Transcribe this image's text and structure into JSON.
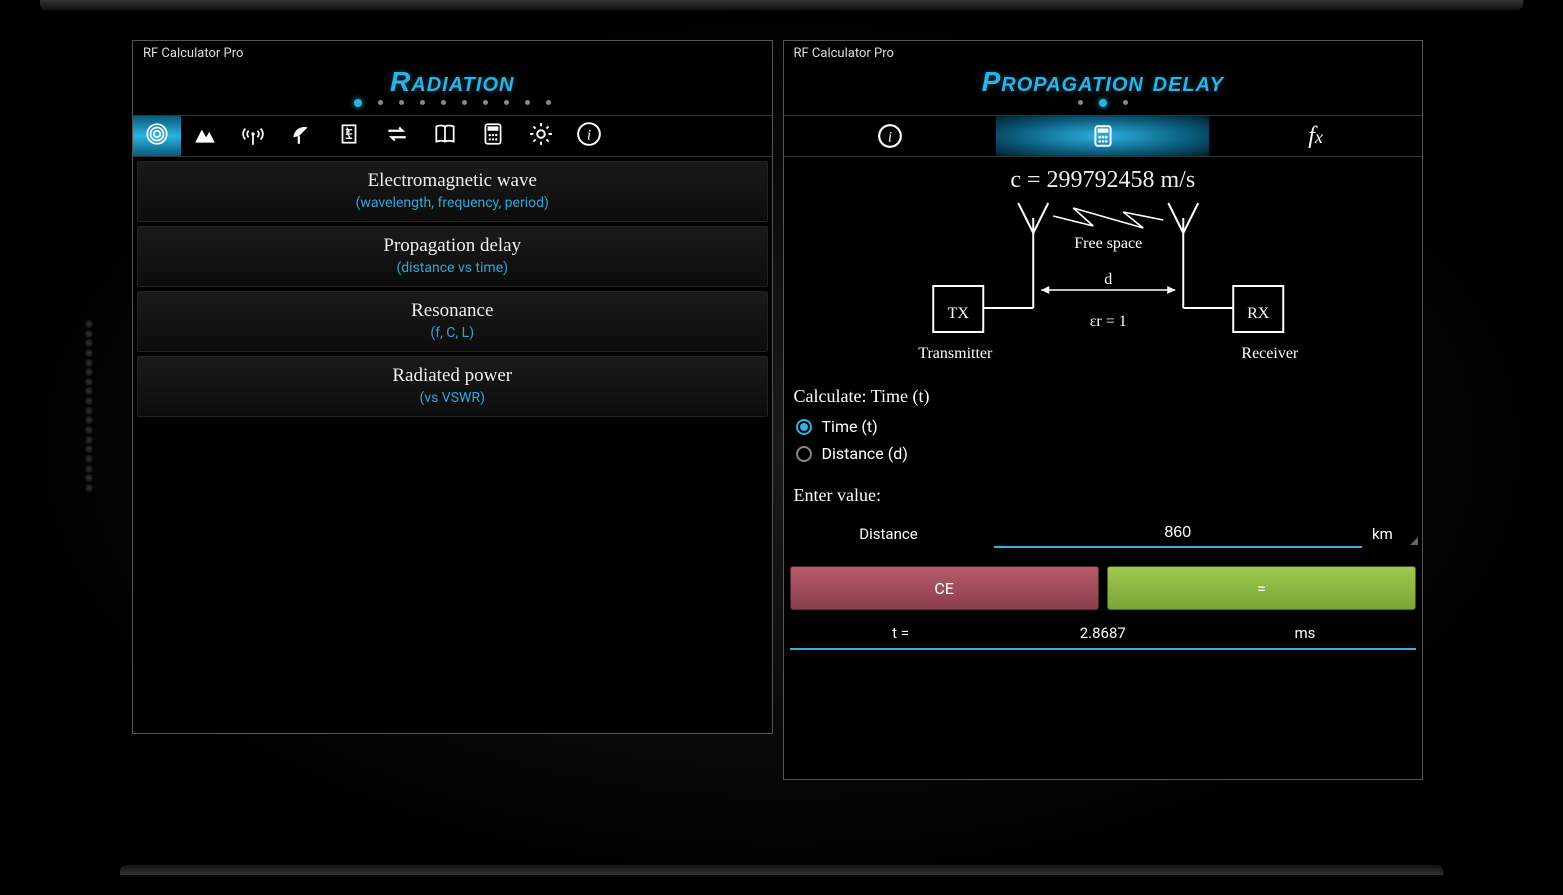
{
  "left": {
    "app_title": "RF Calculator Pro",
    "section_title": "Radiation",
    "dots_total": 10,
    "dots_active": 0,
    "tabs": [
      "radiation",
      "terrain",
      "antenna",
      "dish",
      "power",
      "convert",
      "book",
      "calculator",
      "settings",
      "info"
    ],
    "tabs_active": 0,
    "items": [
      {
        "title": "Electromagnetic wave",
        "sub": "(wavelength, frequency, period)"
      },
      {
        "title": "Propagation delay",
        "sub": "(distance vs time)"
      },
      {
        "title": "Resonance",
        "sub": "(f, C, L)"
      },
      {
        "title": "Radiated power",
        "sub": "(vs VSWR)"
      }
    ]
  },
  "right": {
    "app_title": "RF Calculator Pro",
    "section_title": "Propagation delay",
    "dots_total": 3,
    "dots_active": 1,
    "tabs_active": 1,
    "formula_c": "c = 299792458 m/s",
    "diagram": {
      "free_space": "Free space",
      "tx": "TX",
      "rx": "RX",
      "transmitter": "Transmitter",
      "receiver": "Receiver",
      "d": "d",
      "er": "εr = 1"
    },
    "calculate_label": "Calculate: Time (t)",
    "radio_time": "Time (t)",
    "radio_distance": "Distance (d)",
    "radio_selected": "time",
    "enter_label": "Enter value:",
    "input": {
      "label": "Distance",
      "value": "860",
      "unit": "km"
    },
    "buttons": {
      "ce": "CE",
      "eq": "="
    },
    "result": {
      "label": "t =",
      "value": "2.8687",
      "unit": "ms"
    }
  }
}
